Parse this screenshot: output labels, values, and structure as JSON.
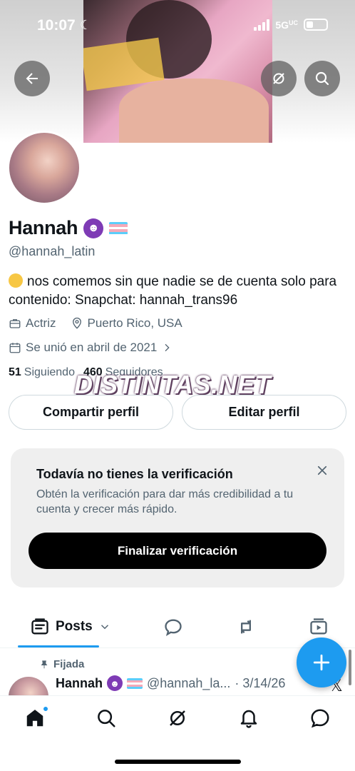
{
  "status_bar": {
    "time": "10:07",
    "network": "5G",
    "network_sup": "UC"
  },
  "profile": {
    "name": "Hannah",
    "handle": "@hannah_latin",
    "bio": "nos comemos sin que nadie se de cuenta solo para contenido: Snapchat: hannah_trans96",
    "profession": "Actriz",
    "location": "Puerto Rico, USA",
    "joined": "Se unió en abril de 2021",
    "following_count": "51",
    "following_label": "Siguiendo",
    "followers_count": "460",
    "followers_label": "Seguidores"
  },
  "watermark": "DISTINTAS.NET",
  "buttons": {
    "share": "Compartir perfil",
    "edit": "Editar perfil"
  },
  "verification": {
    "title": "Todavía no tienes la verificación",
    "description": "Obtén la verificación para dar más credibilidad a tu cuenta y crecer más rápido.",
    "cta": "Finalizar verificación"
  },
  "tabs": {
    "posts": "Posts"
  },
  "pinned_post": {
    "pinned_label": "Fijada",
    "author_name": "Hannah",
    "author_handle": "@hannah_la...",
    "date": "· 3/14/26"
  },
  "colors": {
    "accent": "#1d9bf0",
    "text": "#0f1419",
    "secondary": "#536471"
  }
}
